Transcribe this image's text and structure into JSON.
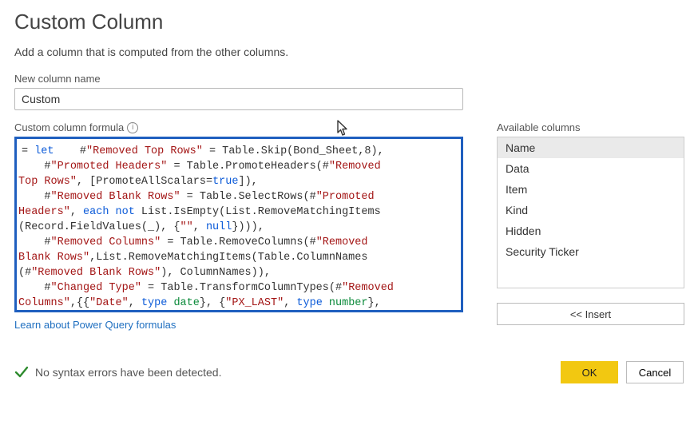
{
  "dialog": {
    "title": "Custom Column",
    "subtitle": "Add a column that is computed from the other columns."
  },
  "name_field": {
    "label": "New column name",
    "value": "Custom"
  },
  "formula": {
    "label": "Custom column formula",
    "info_aria": "Help",
    "tokens": [
      {
        "t": "eq",
        "v": "= "
      },
      {
        "t": "kw",
        "v": "let"
      },
      {
        "t": "txt",
        "v": "    #"
      },
      {
        "t": "str",
        "v": "\"Removed Top Rows\""
      },
      {
        "t": "txt",
        "v": " = Table.Skip(Bond_Sheet,8),\n"
      },
      {
        "t": "txt",
        "v": "    #"
      },
      {
        "t": "str",
        "v": "\"Promoted Headers\""
      },
      {
        "t": "txt",
        "v": " = Table.PromoteHeaders(#"
      },
      {
        "t": "str",
        "v": "\"Removed \nTop Rows\""
      },
      {
        "t": "txt",
        "v": ", [PromoteAllScalars="
      },
      {
        "t": "kw",
        "v": "true"
      },
      {
        "t": "txt",
        "v": "]),\n"
      },
      {
        "t": "txt",
        "v": "    #"
      },
      {
        "t": "str",
        "v": "\"Removed Blank Rows\""
      },
      {
        "t": "txt",
        "v": " = Table.SelectRows(#"
      },
      {
        "t": "str",
        "v": "\"Promoted \nHeaders\""
      },
      {
        "t": "txt",
        "v": ", "
      },
      {
        "t": "kw",
        "v": "each not"
      },
      {
        "t": "txt",
        "v": " List.IsEmpty(List.RemoveMatchingItems\n(Record.FieldValues(_), {"
      },
      {
        "t": "str",
        "v": "\"\""
      },
      {
        "t": "txt",
        "v": ", "
      },
      {
        "t": "kw",
        "v": "null"
      },
      {
        "t": "txt",
        "v": "}))),\n"
      },
      {
        "t": "txt",
        "v": "    #"
      },
      {
        "t": "str",
        "v": "\"Removed Columns\""
      },
      {
        "t": "txt",
        "v": " = Table.RemoveColumns(#"
      },
      {
        "t": "str",
        "v": "\"Removed \nBlank Rows\""
      },
      {
        "t": "txt",
        "v": ",List.RemoveMatchingItems(Table.ColumnNames\n(#"
      },
      {
        "t": "str",
        "v": "\"Removed Blank Rows\""
      },
      {
        "t": "txt",
        "v": "), ColumnNames)),\n"
      },
      {
        "t": "txt",
        "v": "    #"
      },
      {
        "t": "str",
        "v": "\"Changed Type\""
      },
      {
        "t": "txt",
        "v": " = Table.TransformColumnTypes(#"
      },
      {
        "t": "str",
        "v": "\"Removed \nColumns\""
      },
      {
        "t": "txt",
        "v": ",{{"
      },
      {
        "t": "str",
        "v": "\"Date\""
      },
      {
        "t": "txt",
        "v": ", "
      },
      {
        "t": "kw",
        "v": "type"
      },
      {
        "t": "txt",
        "v": " "
      },
      {
        "t": "type",
        "v": "date"
      },
      {
        "t": "txt",
        "v": "}, {"
      },
      {
        "t": "str",
        "v": "\"PX_LAST\""
      },
      {
        "t": "txt",
        "v": ", "
      },
      {
        "t": "kw",
        "v": "type"
      },
      {
        "t": "txt",
        "v": " "
      },
      {
        "t": "type",
        "v": "number"
      },
      {
        "t": "txt",
        "v": "},"
      }
    ],
    "learn_link": "Learn about Power Query formulas"
  },
  "available": {
    "label": "Available columns",
    "items": [
      "Name",
      "Data",
      "Item",
      "Kind",
      "Hidden",
      "Security Ticker"
    ],
    "selected_index": 0,
    "insert_label": "<< Insert"
  },
  "status": {
    "text": "No syntax errors have been detected."
  },
  "buttons": {
    "ok": "OK",
    "cancel": "Cancel"
  }
}
